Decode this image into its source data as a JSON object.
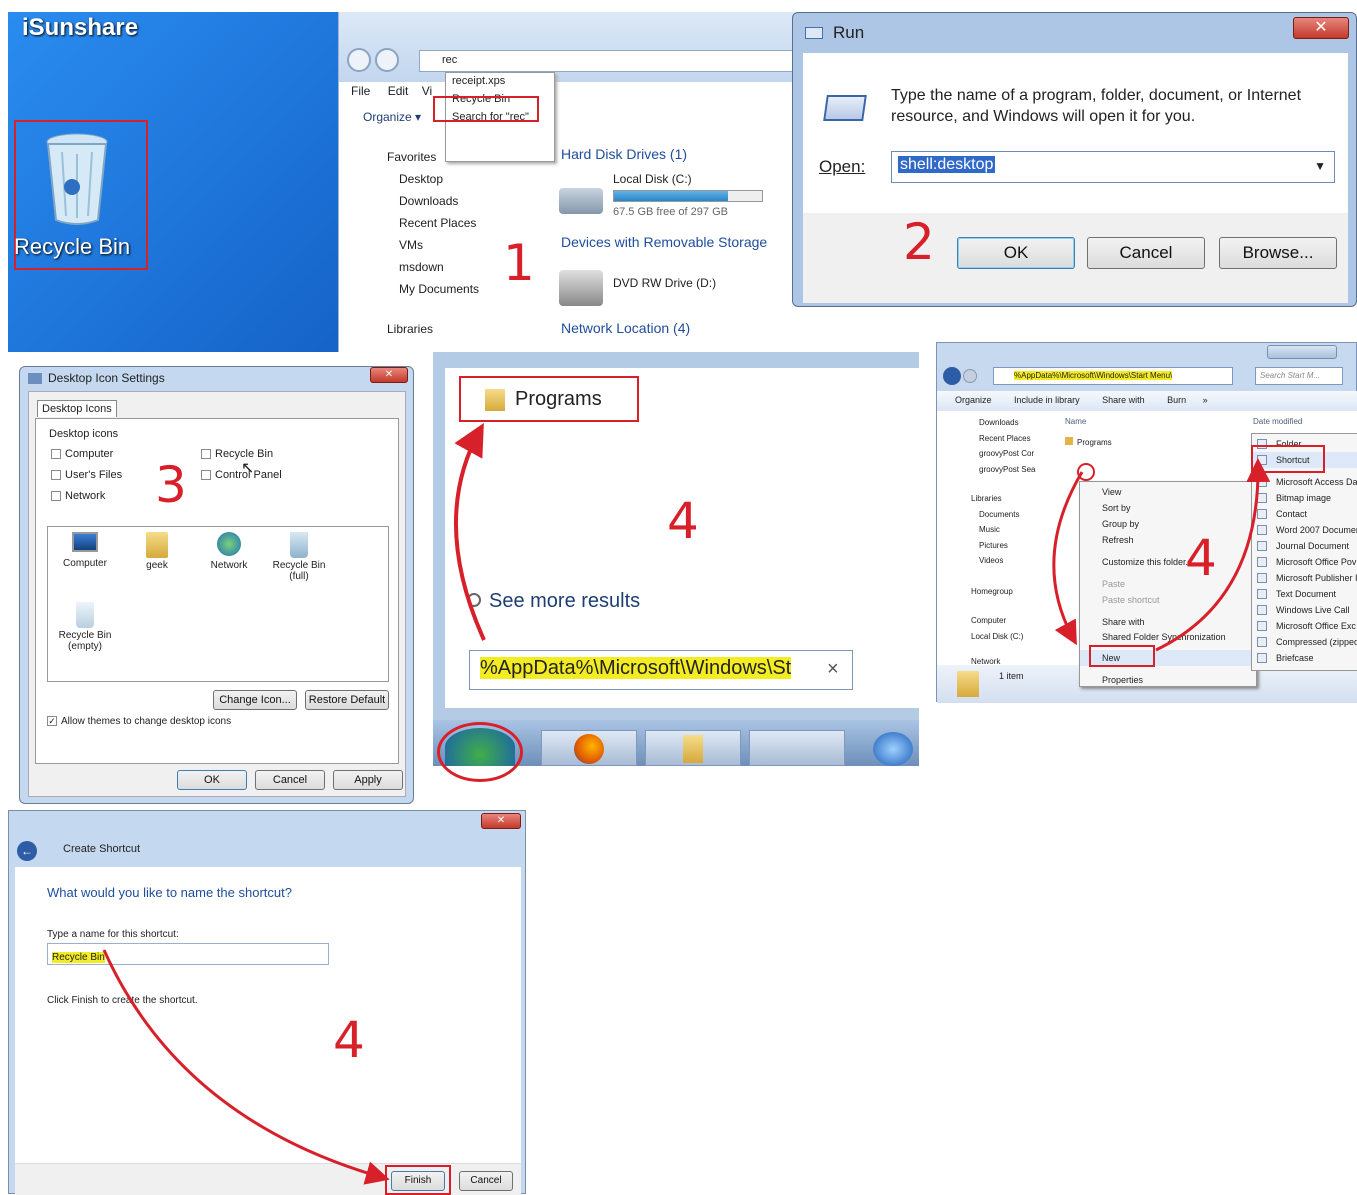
{
  "colors": {
    "accent_red": "#d8202a",
    "desktop_blue": "#1f7be0",
    "highlight_yellow": "#f4ec22",
    "link_blue": "#1e4e9c"
  },
  "panel1": {
    "logo": "iSunshare",
    "desktop_icon_label": "Recycle Bin",
    "search_text": "rec",
    "suggestions": [
      "receipt.xps",
      "Recycle Bin",
      "Search for \"rec\""
    ],
    "menu": [
      "File",
      "Edit",
      "Vi"
    ],
    "organize": "Organize",
    "sidebar": [
      "Favorites",
      "Desktop",
      "Downloads",
      "Recent Places",
      "VMs",
      "msdown",
      "My Documents",
      "Libraries"
    ],
    "section_hdd": "Hard Disk Drives (1)",
    "local_disk": "Local Disk (C:)",
    "disk_free": "67.5 GB free of 297 GB",
    "disk_fill": 0.77,
    "section_removable": "Devices with Removable Storage",
    "dvd": "DVD RW Drive (D:)",
    "section_network": "Network Location (4)",
    "step": "1"
  },
  "run": {
    "title": "Run",
    "desc": "Type the name of a program, folder, document, or Internet resource, and Windows will open it for you.",
    "open_label": "Open:",
    "open_value": "shell:desktop",
    "ok": "OK",
    "cancel": "Cancel",
    "browse": "Browse...",
    "step": "2"
  },
  "dis": {
    "title": "Desktop Icon Settings",
    "tab": "Desktop Icons",
    "group": "Desktop icons",
    "checks": [
      "Computer",
      "User's Files",
      "Network",
      "Recycle Bin",
      "Control Panel"
    ],
    "icons": [
      "Computer",
      "geek",
      "Network",
      "Recycle Bin (full)",
      "Recycle Bin (empty)"
    ],
    "change_icon": "Change Icon...",
    "restore": "Restore Default",
    "allow": "Allow themes to change desktop icons",
    "ok": "OK",
    "cancel": "Cancel",
    "apply": "Apply",
    "step": "3"
  },
  "start": {
    "programs": "Programs",
    "see_more": "See more results",
    "search_value": "%AppData%\\Microsoft\\Windows\\St",
    "clear": "×",
    "step": "4"
  },
  "explorer": {
    "address": "%AppData%\\Microsoft\\Windows\\Start Menu\\",
    "search_placeholder": "Search Start M...",
    "toolbar": [
      "Organize",
      "Include in library",
      "Share with",
      "Burn",
      "»"
    ],
    "nav": [
      "Downloads",
      "Recent Places",
      "groovyPost Cor",
      "groovyPost Sea",
      "Libraries",
      "Documents",
      "Music",
      "Pictures",
      "Videos",
      "Homegroup",
      "Computer",
      "Local Disk (C:)",
      "Network"
    ],
    "col_name": "Name",
    "col_date": "Date modified",
    "file": "Programs",
    "status": "1 item",
    "context": [
      "View",
      "Sort by",
      "Group by",
      "Refresh",
      "Customize this folder...",
      "Paste",
      "Paste shortcut",
      "Share with",
      "Shared Folder Synchronization",
      "New",
      "Properties"
    ],
    "submenu": [
      "Folder",
      "Shortcut",
      "Microsoft Access Da",
      "Bitmap image",
      "Contact",
      "Word 2007 Documen",
      "Journal Document",
      "Microsoft Office Pov",
      "Microsoft Publisher I",
      "Text Document",
      "Windows Live Call",
      "Microsoft Office Exc",
      "Compressed (zipped",
      "Briefcase"
    ],
    "step": "4"
  },
  "shortcut": {
    "title": "Create Shortcut",
    "heading": "What would you like to name the shortcut?",
    "type_label": "Type a name for this shortcut:",
    "name_value": "Recycle Bin",
    "finish_text": "Click Finish to create the shortcut.",
    "finish": "Finish",
    "cancel": "Cancel",
    "step": "4"
  }
}
